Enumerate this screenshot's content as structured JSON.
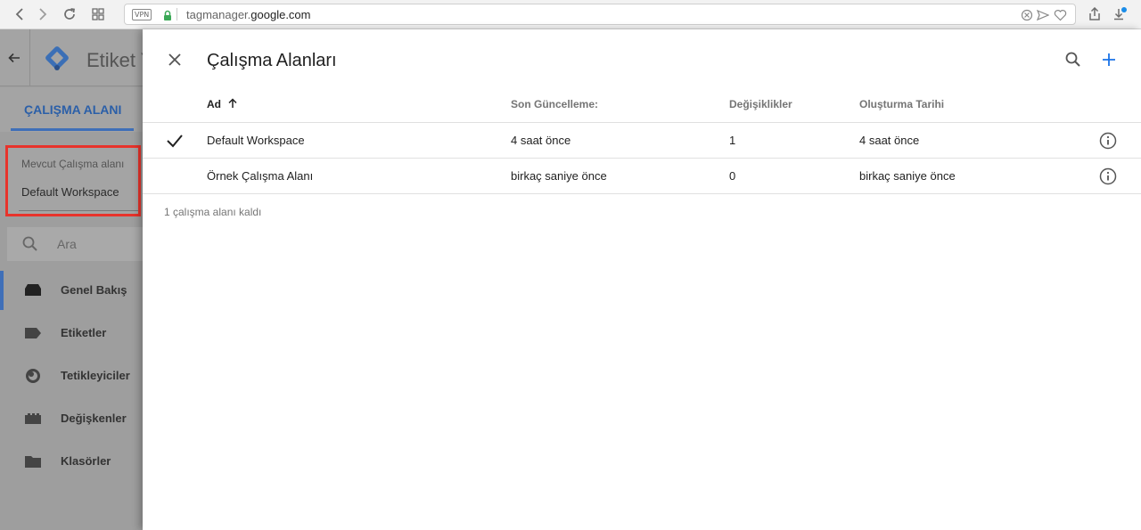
{
  "browser": {
    "vpn": "VPN",
    "url_prefix": "tagmanager.",
    "url_domain": "google.com"
  },
  "sidebar": {
    "title": "Etiket Y",
    "tab_label": "ÇALIŞMA ALANI",
    "workspace_caption": "Mevcut Çalışma alanı",
    "workspace_value": "Default Workspace",
    "search_placeholder": "Ara",
    "items": [
      {
        "label": "Genel Bakış",
        "icon": "overview-icon"
      },
      {
        "label": "Etiketler",
        "icon": "tag-icon"
      },
      {
        "label": "Tetikleyiciler",
        "icon": "trigger-icon"
      },
      {
        "label": "Değişkenler",
        "icon": "variables-icon"
      },
      {
        "label": "Klasörler",
        "icon": "folder-icon"
      }
    ]
  },
  "panel": {
    "title": "Çalışma Alanları",
    "columns": {
      "name": "Ad",
      "updated": "Son Güncelleme:",
      "changes": "Değişiklikler",
      "created": "Oluşturma Tarihi"
    },
    "rows": [
      {
        "name": "Default Workspace",
        "updated": "4 saat önce",
        "changes": "1",
        "created": "4 saat önce",
        "selected": true
      },
      {
        "name": "Örnek Çalışma Alanı",
        "updated": "birkaç saniye önce",
        "changes": "0",
        "created": "birkaç saniye önce",
        "selected": false
      }
    ],
    "footer": "1 çalışma alanı kaldı"
  },
  "colors": {
    "accent": "#1a73e8",
    "highlight": "#e8332b"
  }
}
